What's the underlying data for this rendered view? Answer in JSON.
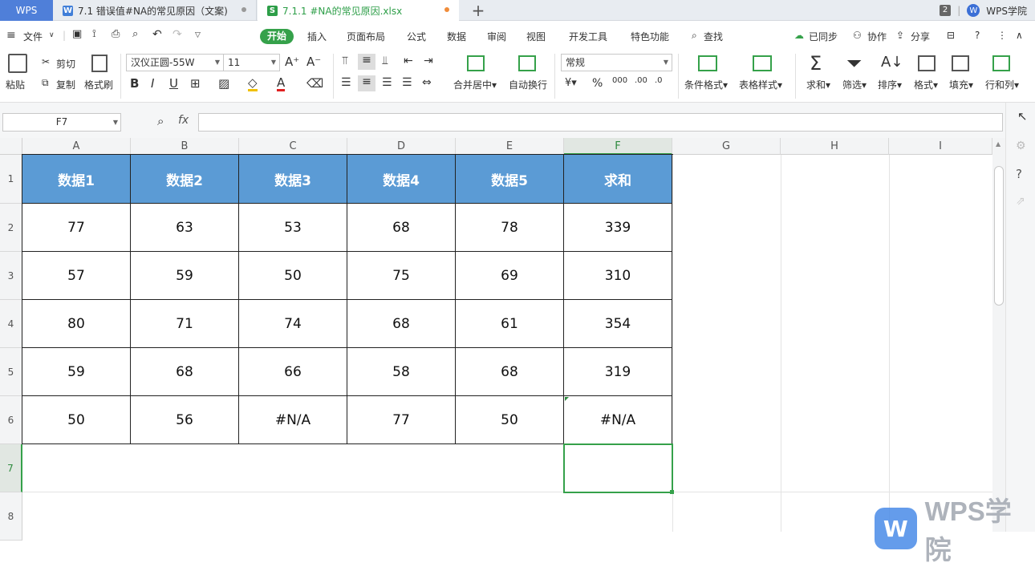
{
  "tabs": {
    "app": "WPS",
    "doc": "7.1 错误值#NA的常见原因（文案)",
    "xls": "7.1.1 #NA的常见原因.xlsx",
    "count": "2",
    "academy": "WPS学院"
  },
  "menu": {
    "file": "文件",
    "items": [
      "开始",
      "插入",
      "页面布局",
      "公式",
      "数据",
      "审阅",
      "视图",
      "开发工具",
      "特色功能"
    ],
    "search": "查找",
    "sync": "已同步",
    "collab": "协作",
    "share": "分享"
  },
  "toolbar": {
    "paste": "粘贴",
    "cut": "剪切",
    "copy": "复制",
    "format_painter": "格式刷",
    "font": "汉仪正圆-55W",
    "size": "11",
    "merge": "合并居中",
    "wrap": "自动换行",
    "number_format": "常规",
    "cond_format": "条件格式",
    "table_style": "表格样式",
    "sum": "求和",
    "filter": "筛选",
    "sort": "排序",
    "format": "格式",
    "fill": "填充",
    "rowcol": "行和列"
  },
  "formula_bar": {
    "namebox": "F7",
    "fx": "fx",
    "content": ""
  },
  "sheet": {
    "columns": [
      "A",
      "B",
      "C",
      "D",
      "E",
      "F",
      "G",
      "H",
      "I"
    ],
    "rows": [
      "1",
      "2",
      "3",
      "4",
      "5",
      "6",
      "7",
      "8"
    ],
    "header": [
      "数据1",
      "数据2",
      "数据3",
      "数据4",
      "数据5",
      "求和"
    ],
    "data": [
      [
        "77",
        "63",
        "53",
        "68",
        "78",
        "339"
      ],
      [
        "57",
        "59",
        "50",
        "75",
        "69",
        "310"
      ],
      [
        "80",
        "71",
        "74",
        "68",
        "61",
        "354"
      ],
      [
        "59",
        "68",
        "66",
        "58",
        "68",
        "319"
      ],
      [
        "50",
        "56",
        "#N/A",
        "77",
        "50",
        "#N/A"
      ]
    ]
  },
  "watermark": {
    "text": "WPS学院",
    "logo": "W"
  }
}
